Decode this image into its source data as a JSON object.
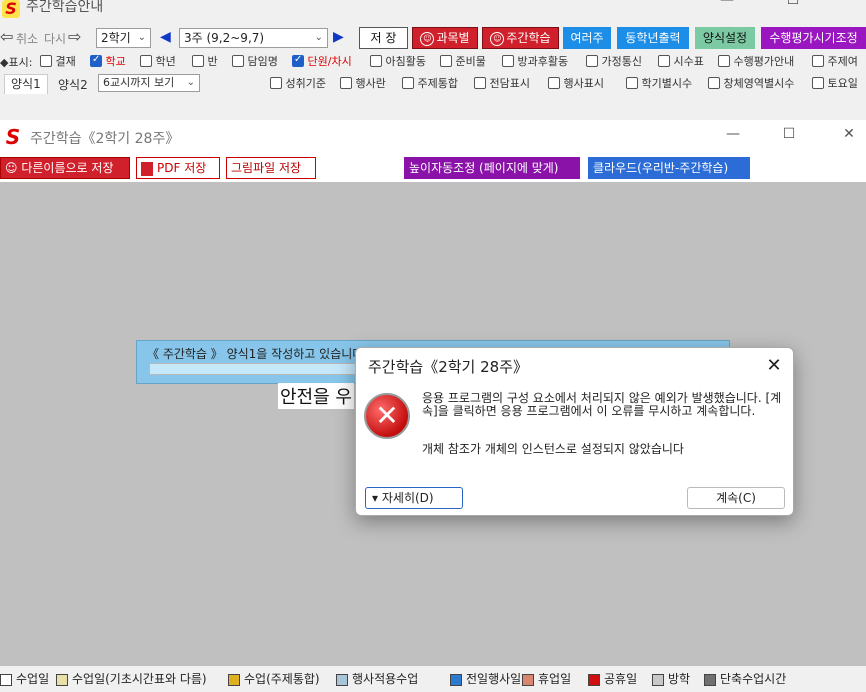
{
  "top_window": {
    "title": "주간학습안내",
    "controls": {
      "minimize": "—",
      "maximize": "☐"
    },
    "toolbar": {
      "undo_label": "취소",
      "redo_label": "다시",
      "semester_select": "2학기",
      "week_select": "3주 (9,2~9,7)",
      "save_label": "저 장",
      "subject_label": "과목별",
      "weekly_label": "주간학습",
      "multi_week_label": "여러주",
      "same_grade_print_label": "동학년출력",
      "format_settings_label": "양식설정",
      "assessment_label": "수행평가시기조정"
    },
    "display_row1": {
      "prefix": "◆표시:",
      "items": [
        {
          "label": "결재",
          "checked": false
        },
        {
          "label": "학교",
          "checked": true
        },
        {
          "label": "학년",
          "checked": false
        },
        {
          "label": "반",
          "checked": false
        },
        {
          "label": "담임명",
          "checked": false
        },
        {
          "label": "단원/차시",
          "checked": true
        },
        {
          "label": "아침활동",
          "checked": false
        },
        {
          "label": "준비물",
          "checked": false
        },
        {
          "label": "방과후활동",
          "checked": false
        },
        {
          "label": "가정통신",
          "checked": false
        },
        {
          "label": "시수표",
          "checked": false
        },
        {
          "label": "수행평가안내",
          "checked": false
        },
        {
          "label": "주제여",
          "checked": false
        }
      ]
    },
    "display_row2": {
      "tabs": [
        "양식1",
        "양식2"
      ],
      "period_select": "6교시까지 보기",
      "items": [
        {
          "label": "성취기준",
          "checked": false
        },
        {
          "label": "행사란",
          "checked": false
        },
        {
          "label": "주제통합",
          "checked": false
        },
        {
          "label": "전담표시",
          "checked": false
        },
        {
          "label": "행사표시",
          "checked": false
        },
        {
          "label": "학기별시수",
          "checked": false
        },
        {
          "label": "창체영역별시수",
          "checked": false
        },
        {
          "label": "토요일",
          "checked": false
        }
      ]
    }
  },
  "inner_window": {
    "title": "주간학습《2학기 28주》",
    "toolbar": {
      "save_as_label": "다른이름으로 저장",
      "pdf_save_label": "PDF 저장",
      "image_save_label": "그림파일 저장",
      "auto_height_label": "높이자동조정 (페이지에 맞게)",
      "cloud_label": "클라우드(우리반-주간학습)"
    },
    "progress": {
      "text": "《 주간학습 》 양식1을 작성하고 있습니다",
      "value": 0.37
    },
    "safe_text": "안전을 우",
    "legend": [
      {
        "label": "수업일",
        "color": "#ffffff"
      },
      {
        "label": "수업일(기초시간표와 다름)",
        "color": "#e8e0a8"
      },
      {
        "label": "수업(주제통합)",
        "color": "#e0b020"
      },
      {
        "label": "행사적용수업",
        "color": "#a8c4d8"
      },
      {
        "label": "전일행사일",
        "color": "#2a7ad0"
      },
      {
        "label": "휴업일",
        "color": "#d88870"
      },
      {
        "label": "공휴일",
        "color": "#d01010"
      },
      {
        "label": "방학",
        "color": "#c8c8c8"
      },
      {
        "label": "단축수업시간",
        "color": "#707070"
      }
    ]
  },
  "dialog": {
    "title": "주간학습《2학기 28주》",
    "close": "✕",
    "message": "응용 프로그램의 구성 요소에서 처리되지 않은 예외가 발생했습니다. [계속]을 클릭하면 응용 프로그램에서 이 오류를 무시하고 계속합니다.",
    "detail": "개체 참조가 개체의 인스턴스로 설정되지 않았습니다",
    "details_button": "자세히(D)",
    "continue_button": "계속(C)"
  }
}
